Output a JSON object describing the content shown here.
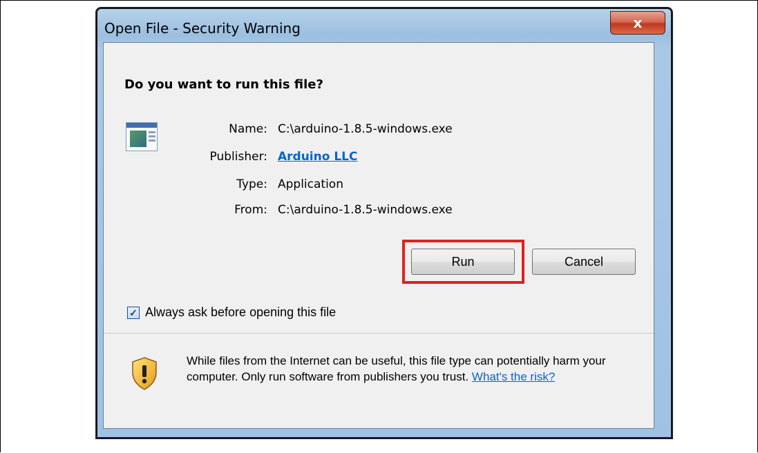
{
  "window": {
    "title": "Open File - Security Warning",
    "close_symbol": "x"
  },
  "dialog": {
    "heading": "Do you want to run this file?",
    "fields": {
      "name_label": "Name:",
      "name_value": "C:\\arduino-1.8.5-windows.exe",
      "publisher_label": "Publisher:",
      "publisher_value": "Arduino LLC",
      "type_label": "Type:",
      "type_value": "Application",
      "from_label": "From:",
      "from_value": "C:\\arduino-1.8.5-windows.exe"
    },
    "buttons": {
      "run_label": "Run",
      "cancel_label": "Cancel"
    },
    "checkbox": {
      "label": "Always ask before opening this file",
      "checked": true
    },
    "warning": {
      "text": "While files from the Internet can be useful, this file type can potentially harm your computer. Only run software from publishers you trust.",
      "link_label": "What's the risk?"
    }
  },
  "colors": {
    "highlight": "#e02020",
    "link": "#0066cc"
  },
  "icons": [
    "application-icon",
    "close-icon",
    "check-icon",
    "shield-warning-icon"
  ]
}
